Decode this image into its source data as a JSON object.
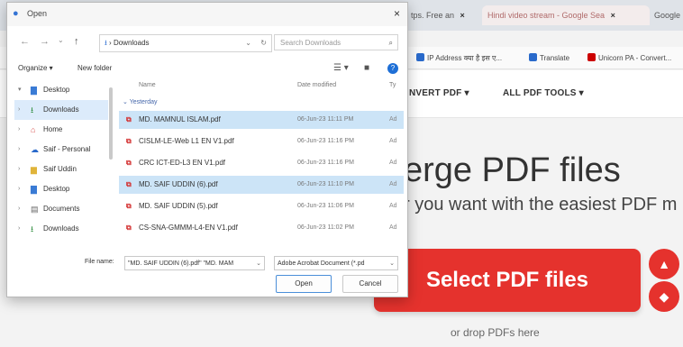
{
  "browser": {
    "tabs": [
      {
        "label": "tps. Free an",
        "close": "×"
      },
      {
        "label": "Hindi video stream - Google Sea",
        "close": "×"
      },
      {
        "label": "Google",
        "close": ""
      }
    ],
    "bookmarks": [
      {
        "label": "IP Address क्या है इस ए...",
        "color": "#2a6acb"
      },
      {
        "label": "Translate",
        "color": "#2a6acb"
      },
      {
        "label": "Unicorn PA - Convert...",
        "color": "#cc0000"
      }
    ]
  },
  "site": {
    "nav": [
      "NVERT PDF ▾",
      "ALL PDF TOOLS ▾"
    ],
    "hero_title": "erge PDF files",
    "hero_subtitle": "r you want with the easiest PDF m",
    "select_button": "Select PDF files",
    "drop_hint": "or drop PDFs here",
    "accent": "#e5322d"
  },
  "dialog": {
    "title": "Open",
    "close": "×",
    "address": "Downloads",
    "address_sep": "›",
    "search_placeholder": "Search Downloads",
    "organize": "Organize ▾",
    "new_folder": "New folder",
    "view_label": "☰ ▾",
    "help": "?",
    "nav_items": [
      {
        "label": "Desktop",
        "icon": "▇",
        "icon_color": "#3a7bd5",
        "expand": "▾",
        "selected": false
      },
      {
        "label": "Downloads",
        "icon": "⭳",
        "icon_color": "#2a8a3a",
        "expand": "›",
        "selected": true
      },
      {
        "label": "Home",
        "icon": "⌂",
        "icon_color": "#d9534f",
        "expand": "›",
        "selected": false
      },
      {
        "label": "Saif - Personal",
        "icon": "☁",
        "icon_color": "#2a6acb",
        "expand": "›",
        "selected": false
      },
      {
        "label": "Saif Uddin",
        "icon": "▆",
        "icon_color": "#e0b43a",
        "expand": "›",
        "selected": false
      },
      {
        "label": "Desktop",
        "icon": "▇",
        "icon_color": "#3a7bd5",
        "expand": "›",
        "selected": false
      },
      {
        "label": "Documents",
        "icon": "▤",
        "icon_color": "#666666",
        "expand": "›",
        "selected": false
      },
      {
        "label": "Downloads",
        "icon": "⭳",
        "icon_color": "#2a8a3a",
        "expand": "›",
        "selected": false
      }
    ],
    "columns": {
      "name": "Name",
      "date": "Date modified",
      "type": "Ty"
    },
    "group": "Yesterday",
    "files": [
      {
        "name": "MD. MAMNUL ISLAM.pdf",
        "date": "06-Jun-23 11:11 PM",
        "type": "Ad",
        "selected": true
      },
      {
        "name": "CISLM-LE-Web L1 EN V1.pdf",
        "date": "06-Jun-23 11:16 PM",
        "type": "Ad",
        "selected": false
      },
      {
        "name": "CRC ICT-ED-L3 EN V1.pdf",
        "date": "06-Jun-23 11:16 PM",
        "type": "Ad",
        "selected": false
      },
      {
        "name": "MD. SAIF UDDIN (6).pdf",
        "date": "06-Jun-23 11:10 PM",
        "type": "Ad",
        "selected": true
      },
      {
        "name": "MD. SAIF UDDIN (5).pdf",
        "date": "06-Jun-23 11:06 PM",
        "type": "Ad",
        "selected": false
      },
      {
        "name": "CS-SNA-GMMM-L4-EN V1.pdf",
        "date": "06-Jun-23 11:02 PM",
        "type": "Ad",
        "selected": false
      }
    ],
    "file_name_label": "File name:",
    "file_name_value": "\"MD. SAIF UDDIN (6).pdf\" \"MD. MAM",
    "file_type_value": "Adobe Acrobat Document (*.pd",
    "open_button": "Open",
    "cancel_button": "Cancel"
  }
}
